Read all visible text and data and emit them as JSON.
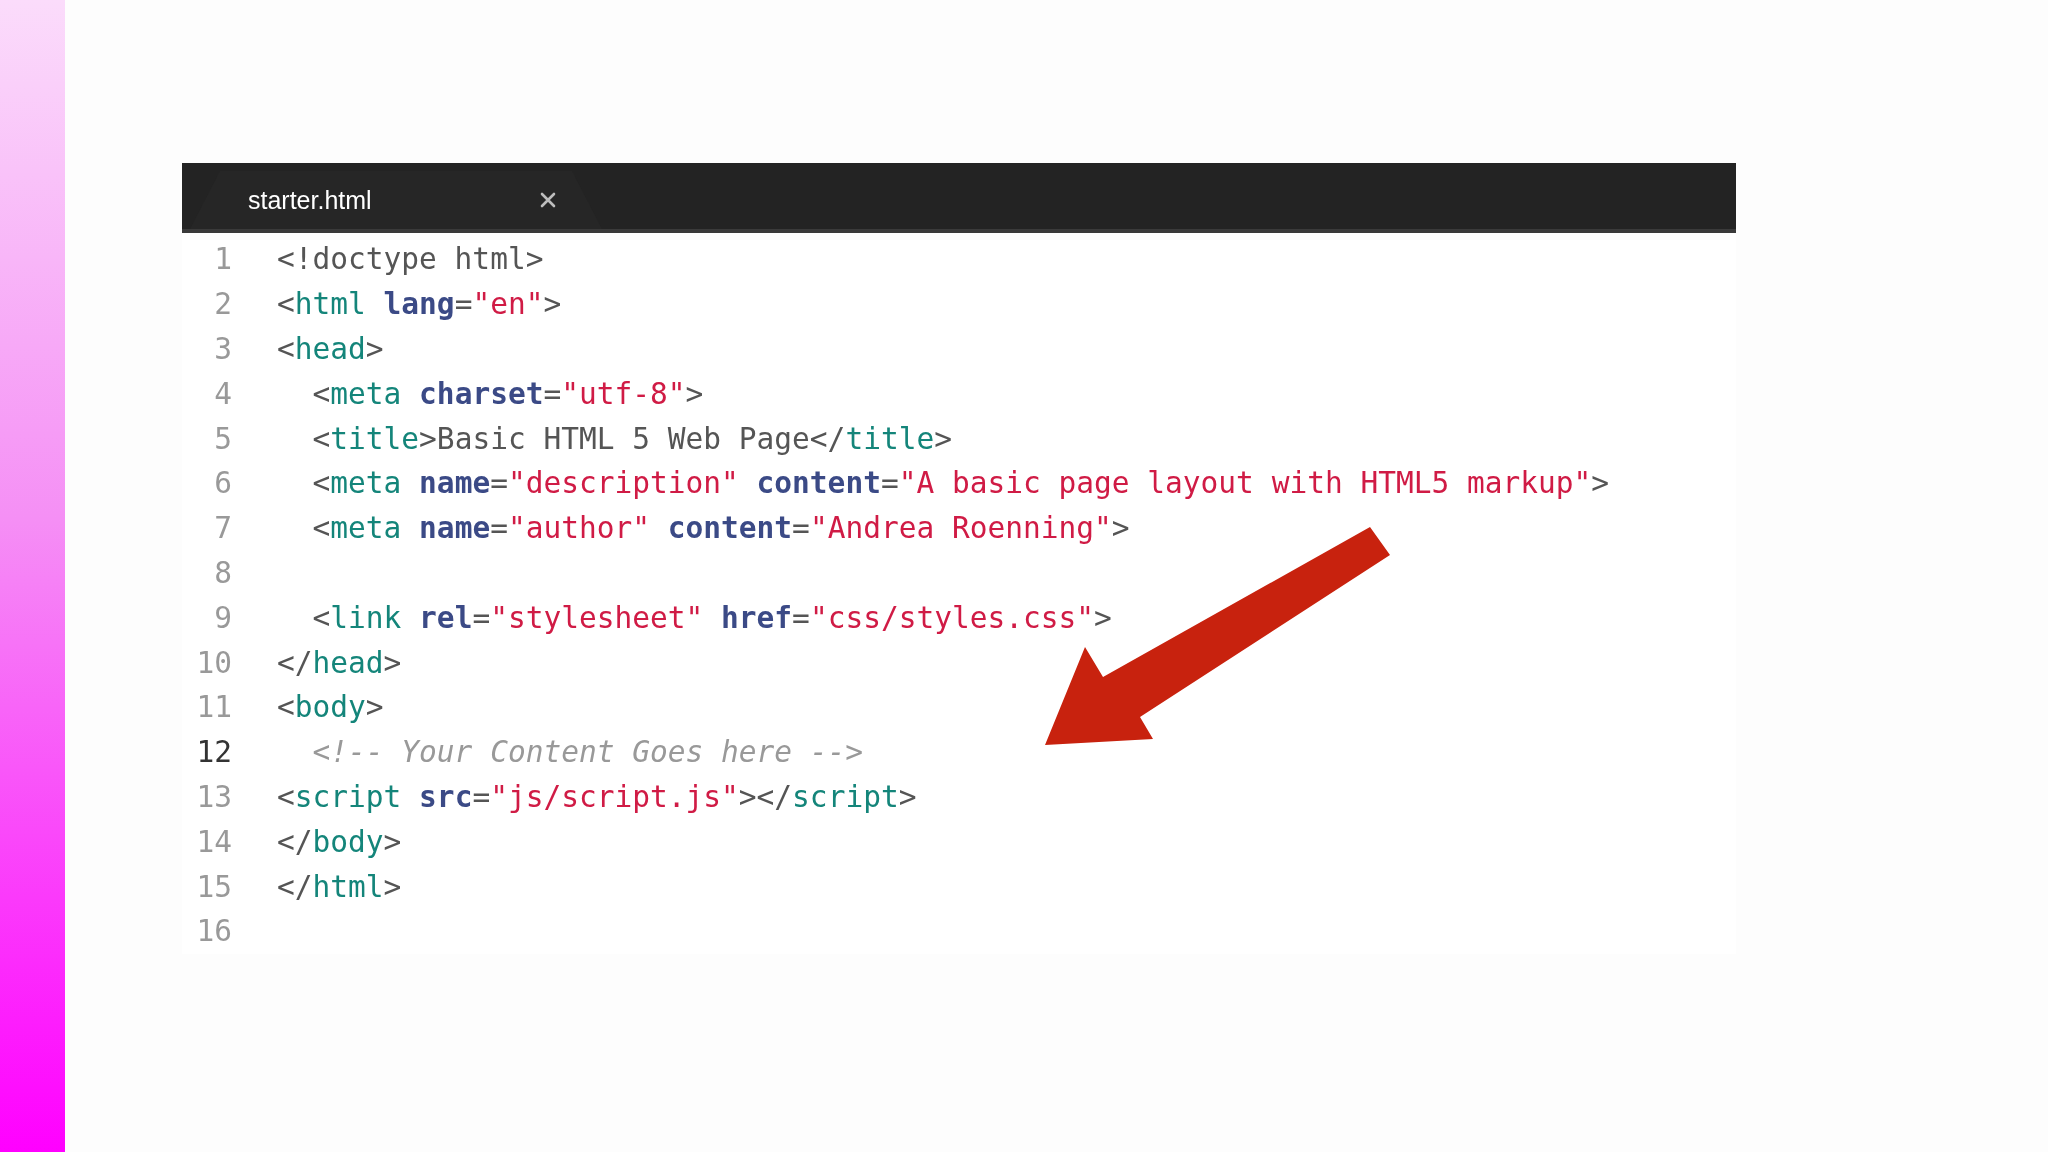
{
  "tabs": [
    {
      "label": "starter.html",
      "selected": true
    }
  ],
  "lines": [
    {
      "number": "1",
      "current": false,
      "tokens": [
        {
          "kind": "punct",
          "text": "<!doctype html>"
        }
      ]
    },
    {
      "number": "2",
      "current": false,
      "tokens": [
        {
          "kind": "punct",
          "text": "<"
        },
        {
          "kind": "tag",
          "text": "html"
        },
        {
          "kind": "attr",
          "text": " lang"
        },
        {
          "kind": "punct",
          "text": "="
        },
        {
          "kind": "string",
          "text": "\"en\""
        },
        {
          "kind": "punct",
          "text": ">"
        }
      ]
    },
    {
      "number": "3",
      "current": false,
      "tokens": [
        {
          "kind": "punct",
          "text": "<"
        },
        {
          "kind": "tag",
          "text": "head"
        },
        {
          "kind": "punct",
          "text": ">"
        }
      ]
    },
    {
      "number": "4",
      "current": false,
      "tokens": [
        {
          "kind": "punct",
          "text": "  <"
        },
        {
          "kind": "tag",
          "text": "meta"
        },
        {
          "kind": "attr",
          "text": " charset"
        },
        {
          "kind": "punct",
          "text": "="
        },
        {
          "kind": "string",
          "text": "\"utf-8\""
        },
        {
          "kind": "punct",
          "text": ">"
        }
      ]
    },
    {
      "number": "5",
      "current": false,
      "tokens": [
        {
          "kind": "punct",
          "text": "  <"
        },
        {
          "kind": "tag",
          "text": "title"
        },
        {
          "kind": "punct",
          "text": ">Basic HTML 5 Web Page</"
        },
        {
          "kind": "tag",
          "text": "title"
        },
        {
          "kind": "punct",
          "text": ">"
        }
      ]
    },
    {
      "number": "6",
      "current": false,
      "tokens": [
        {
          "kind": "punct",
          "text": "  <"
        },
        {
          "kind": "tag",
          "text": "meta"
        },
        {
          "kind": "attr",
          "text": " name"
        },
        {
          "kind": "punct",
          "text": "="
        },
        {
          "kind": "string",
          "text": "\"description\""
        },
        {
          "kind": "attr",
          "text": " content"
        },
        {
          "kind": "punct",
          "text": "="
        },
        {
          "kind": "string",
          "text": "\"A basic page layout with HTML5 markup\""
        },
        {
          "kind": "punct",
          "text": ">"
        }
      ]
    },
    {
      "number": "7",
      "current": false,
      "tokens": [
        {
          "kind": "punct",
          "text": "  <"
        },
        {
          "kind": "tag",
          "text": "meta"
        },
        {
          "kind": "attr",
          "text": " name"
        },
        {
          "kind": "punct",
          "text": "="
        },
        {
          "kind": "string",
          "text": "\"author\""
        },
        {
          "kind": "attr",
          "text": " content"
        },
        {
          "kind": "punct",
          "text": "="
        },
        {
          "kind": "string",
          "text": "\"Andrea Roenning\""
        },
        {
          "kind": "punct",
          "text": ">"
        }
      ]
    },
    {
      "number": "8",
      "current": false
    },
    {
      "number": "9",
      "current": false,
      "tokens": [
        {
          "kind": "punct",
          "text": "  <"
        },
        {
          "kind": "tag",
          "text": "link"
        },
        {
          "kind": "attr",
          "text": " rel"
        },
        {
          "kind": "punct",
          "text": "="
        },
        {
          "kind": "string",
          "text": "\"stylesheet\""
        },
        {
          "kind": "attr",
          "text": " href"
        },
        {
          "kind": "punct",
          "text": "="
        },
        {
          "kind": "string",
          "text": "\"css/styles.css\""
        },
        {
          "kind": "punct",
          "text": ">"
        }
      ]
    },
    {
      "number": "10",
      "current": false,
      "tokens": [
        {
          "kind": "punct",
          "text": "</"
        },
        {
          "kind": "tag",
          "text": "head"
        },
        {
          "kind": "punct",
          "text": ">"
        }
      ]
    },
    {
      "number": "11",
      "current": false,
      "tokens": [
        {
          "kind": "punct",
          "text": "<"
        },
        {
          "kind": "tag",
          "text": "body"
        },
        {
          "kind": "punct",
          "text": ">"
        }
      ]
    },
    {
      "number": "12",
      "current": true,
      "tokens": [
        {
          "kind": "comment",
          "text": "  <!-- Your Content Goes here -->"
        }
      ]
    },
    {
      "number": "13",
      "current": false,
      "tokens": [
        {
          "kind": "punct",
          "text": "<"
        },
        {
          "kind": "tag",
          "text": "script"
        },
        {
          "kind": "attr",
          "text": " src"
        },
        {
          "kind": "punct",
          "text": "="
        },
        {
          "kind": "string",
          "text": "\"js/script.js\""
        },
        {
          "kind": "punct",
          "text": "></"
        },
        {
          "kind": "tag",
          "text": "script"
        },
        {
          "kind": "punct",
          "text": ">"
        }
      ]
    },
    {
      "number": "14",
      "current": false,
      "tokens": [
        {
          "kind": "punct",
          "text": "</"
        },
        {
          "kind": "tag",
          "text": "body"
        },
        {
          "kind": "punct",
          "text": ">"
        }
      ]
    },
    {
      "number": "15",
      "current": false,
      "tokens": [
        {
          "kind": "punct",
          "text": "</"
        },
        {
          "kind": "tag",
          "text": "html"
        },
        {
          "kind": "punct",
          "text": ">"
        }
      ]
    },
    {
      "number": "16",
      "current": false
    }
  ]
}
